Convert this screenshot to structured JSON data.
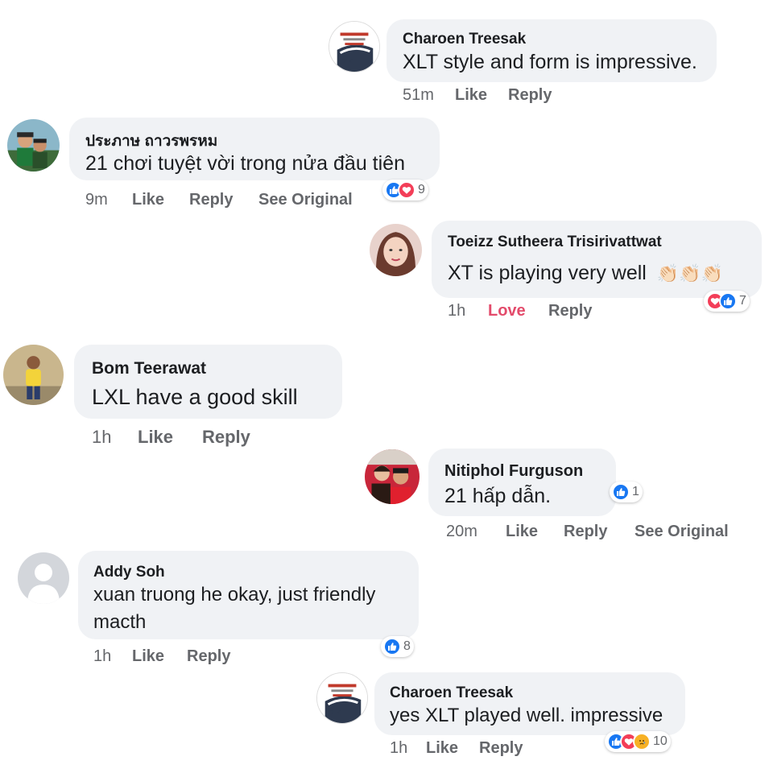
{
  "comments": [
    {
      "author": "Charoen Treesak",
      "text": "XLT style and form is impressive.",
      "time": "51m",
      "like": "Like",
      "reply": "Reply",
      "avatar": "logo-avatar"
    },
    {
      "author": "ประภาษ ถาวรพรหม",
      "text": "21 chơi tuyệt vời trong nửa đầu tiên",
      "time": "9m",
      "like": "Like",
      "reply": "Reply",
      "see_original": "See Original",
      "reactions": [
        "like",
        "love"
      ],
      "reaction_count": "9",
      "avatar": "photo-avatar"
    },
    {
      "author": "Toeizz Sutheera Trisirivattwat",
      "text": "XT is playing very well",
      "emoji": "👏🏻👏🏻👏🏻",
      "time": "1h",
      "like": "Love",
      "reply": "Reply",
      "reactions": [
        "love",
        "like"
      ],
      "reaction_count": "7",
      "avatar": "photo-avatar"
    },
    {
      "author": "Bom Teerawat",
      "text": "LXL have a good skill",
      "time": "1h",
      "like": "Like",
      "reply": "Reply",
      "avatar": "photo-avatar"
    },
    {
      "author": "Nitiphol Furguson",
      "text": "21 hấp dẫn.",
      "time": "20m",
      "like": "Like",
      "reply": "Reply",
      "see_original": "See Original",
      "reactions": [
        "like"
      ],
      "reaction_count": "1",
      "avatar": "photo-avatar"
    },
    {
      "author": "Addy Soh",
      "text": "xuan truong he okay, just friendly macth",
      "time": "1h",
      "like": "Like",
      "reply": "Reply",
      "reactions": [
        "like"
      ],
      "reaction_count": "8",
      "avatar": "default-avatar"
    },
    {
      "author": "Charoen Treesak",
      "text": "yes XLT played well. impressive",
      "time": "1h",
      "like": "Like",
      "reply": "Reply",
      "reactions": [
        "like",
        "love",
        "sad"
      ],
      "reaction_count": "10",
      "avatar": "logo-avatar"
    }
  ],
  "colors": {
    "bubble": "#f0f2f5",
    "like_blue": "#1877f2",
    "love_red": "#f33e58",
    "love_text": "#e34b6b",
    "meta_gray": "#65676b"
  }
}
